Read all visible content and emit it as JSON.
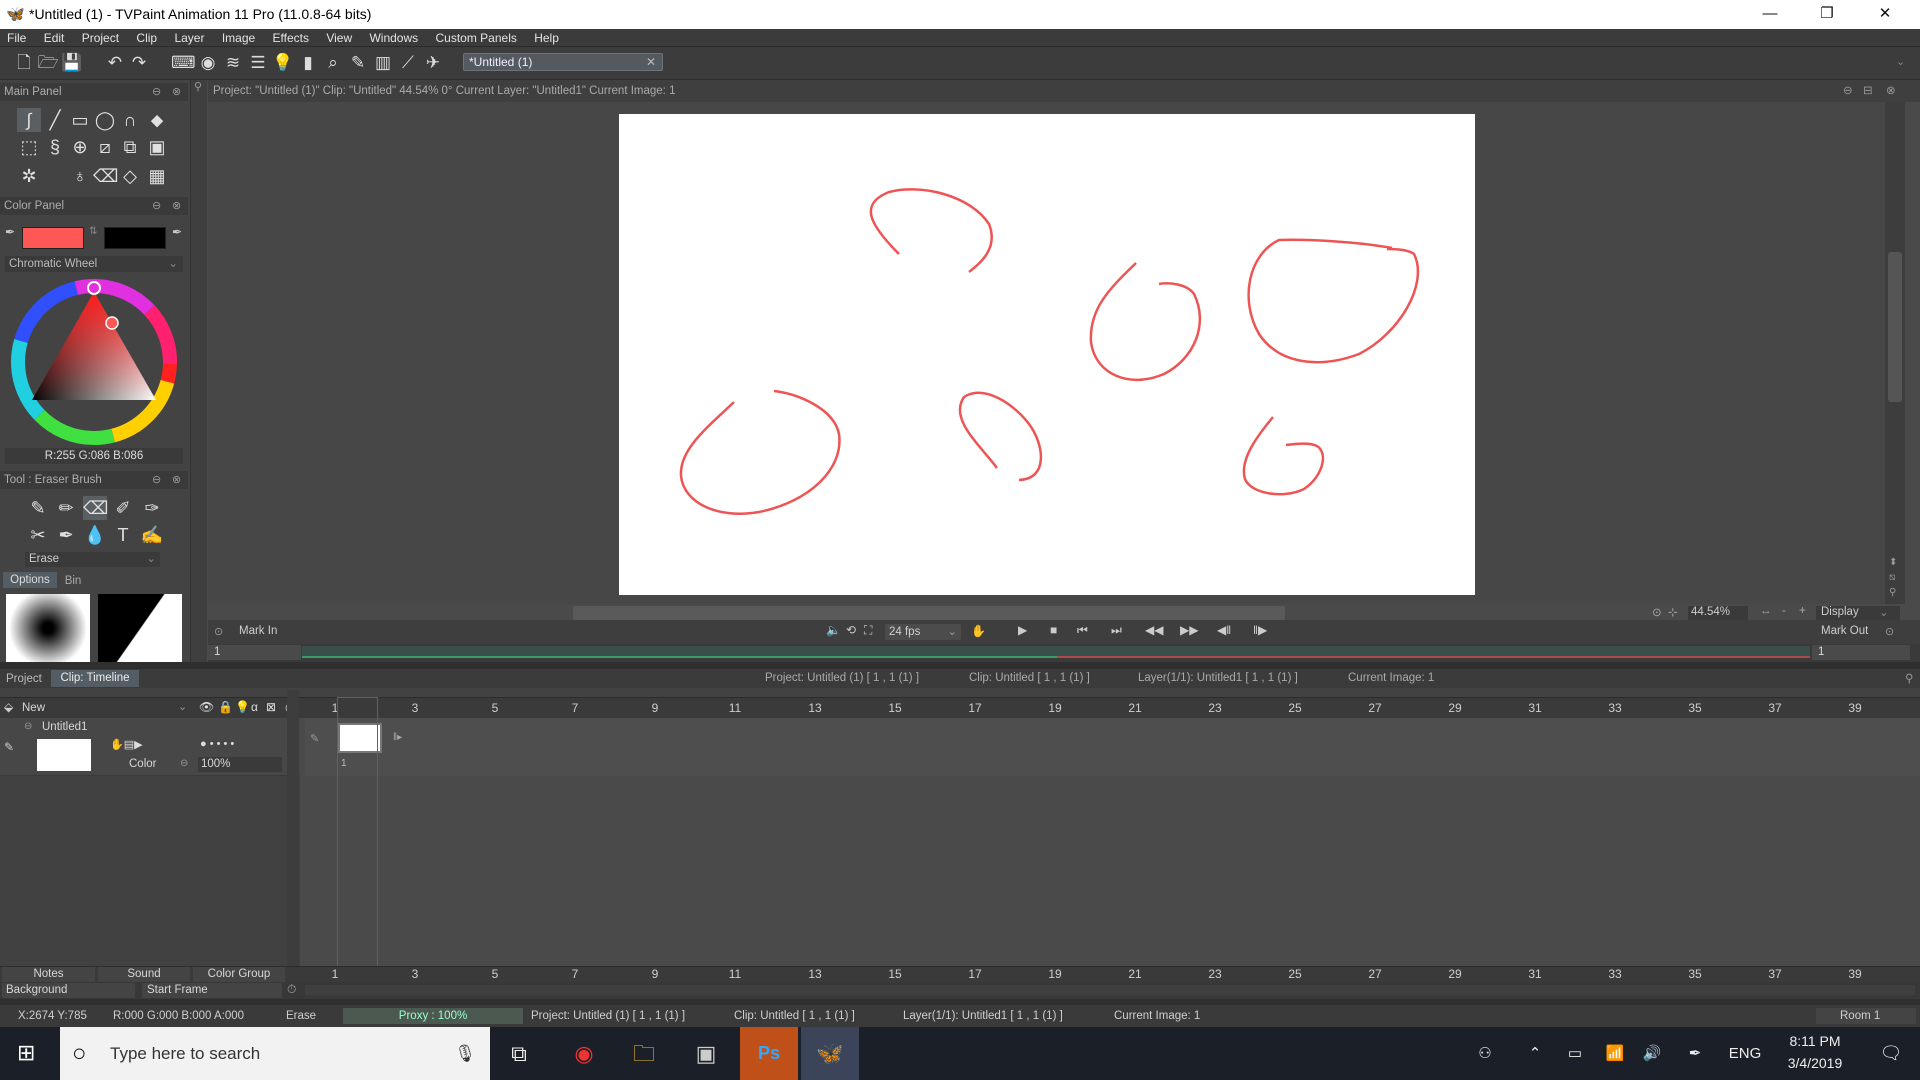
{
  "window": {
    "title": "*Untitled (1) - TVPaint Animation 11 Pro (11.0.8-64 bits)"
  },
  "menu": [
    "File",
    "Edit",
    "Project",
    "Clip",
    "Layer",
    "Image",
    "Effects",
    "View",
    "Windows",
    "Custom Panels",
    "Help"
  ],
  "document_tab": "*Untitled (1)",
  "panels": {
    "main_panel": "Main Panel",
    "color_panel": "Color Panel",
    "color_mode": "Chromatic Wheel",
    "rgb_readout": "R:255 G:086 B:086",
    "primary_color": "#ff5656",
    "secondary_color": "#000000",
    "tool_panel": "Tool : Eraser Brush",
    "tool_mode": "Erase",
    "tabs": [
      "Options",
      "Bin"
    ]
  },
  "viewport": {
    "info": "Project: \"Untitled (1)\" Clip: \"Untitled\"   44.54%   0°  Current Layer: \"Untitled1\"  Current Image: 1",
    "stroke_color": "#ee5454",
    "zoom": "44.54%",
    "display": "Display"
  },
  "playback": {
    "mark_in": "Mark In",
    "mark_out": "Mark Out",
    "fps": "24 fps",
    "in_value": "1",
    "out_value": "1"
  },
  "timeline": {
    "tabs": [
      "Project",
      "Clip: Timeline"
    ],
    "info": [
      "Project: Untitled (1) [ 1 , 1  (1) ]",
      "Clip: Untitled [ 1 , 1  (1) ]",
      "Layer(1/1): Untitled1 [ 1 , 1  (1) ]",
      "Current Image: 1"
    ],
    "new_label": "New",
    "layer_name": "Untitled1",
    "layer_mode": "Color",
    "layer_opacity": "100%",
    "frame_numbers": [
      "1",
      "3",
      "5",
      "7",
      "9",
      "11",
      "13",
      "15",
      "17",
      "19",
      "21",
      "23",
      "25",
      "27",
      "29",
      "31",
      "33",
      "35",
      "37",
      "39"
    ],
    "current_frame": "1",
    "bottom_tabs": [
      "Notes",
      "Sound",
      "Color Group"
    ],
    "background": "Background",
    "start_frame": "Start Frame"
  },
  "status": {
    "coords": "X:2674  Y:785",
    "rgba": "R:000 G:000 B:000 A:000",
    "tool": "Erase",
    "proxy": "Proxy : 100%",
    "project": "Project: Untitled (1) [ 1 , 1  (1) ]",
    "clip": "Clip: Untitled [ 1 , 1  (1) ]",
    "layer": "Layer(1/1): Untitled1 [ 1 , 1  (1) ]",
    "image": "Current Image: 1",
    "room": "Room 1"
  },
  "taskbar": {
    "search_placeholder": "Type here to search",
    "lang": "ENG",
    "time": "8:11 PM",
    "date": "3/4/2019"
  }
}
